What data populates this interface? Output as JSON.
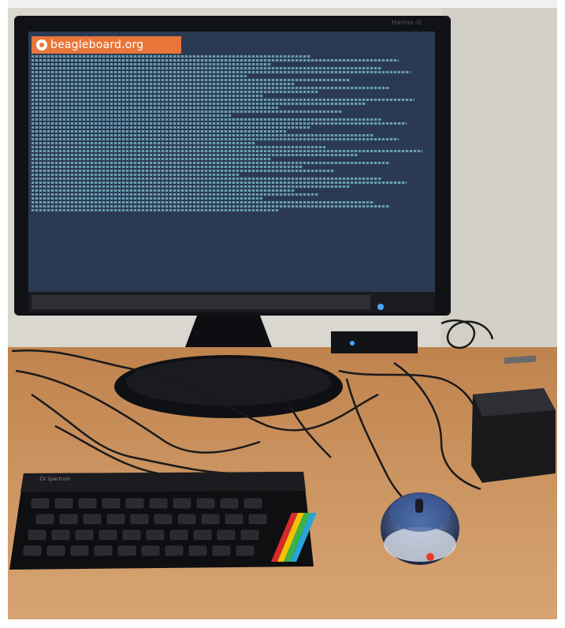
{
  "photo": {
    "scene": "Desktop computer setup",
    "banner_title": "beagleboard.org",
    "monitor_brand": "Hanns-G",
    "keyboard_brand": "ZX Spectrum",
    "console_color": "#8fd8ec",
    "banner_color": "#e8763a"
  }
}
